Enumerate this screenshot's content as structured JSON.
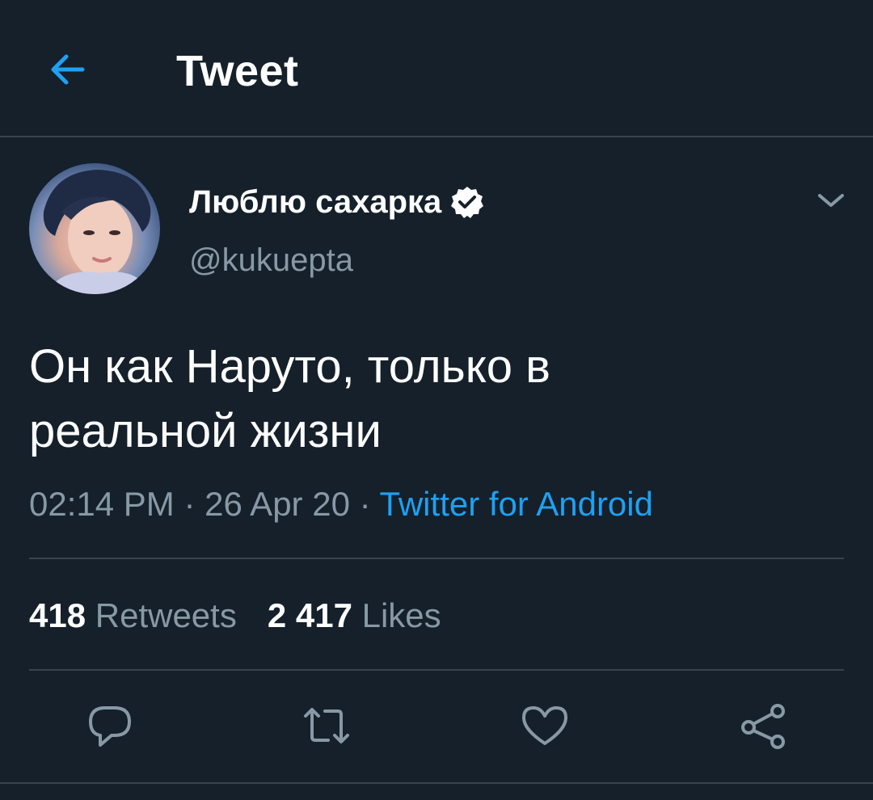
{
  "header": {
    "back_icon": "arrow-left-icon",
    "title": "Tweet"
  },
  "colors": {
    "background": "#15202b",
    "accent": "#1da1f2",
    "secondary_text": "#8899a6",
    "divider": "#38444d"
  },
  "tweet": {
    "author": {
      "display_name": "Люблю сахарка",
      "verified": true,
      "handle": "@kukuepta"
    },
    "text_line1": "Он как Наруто, только в",
    "text_line2": "реальной жизни",
    "time": "02:14 PM",
    "date": "26 Apr 20",
    "separator": " · ",
    "source": "Twitter for Android"
  },
  "stats": {
    "retweets_count": "418",
    "retweets_label": "Retweets",
    "likes_count": "2 417",
    "likes_label": "Likes"
  },
  "actions": {
    "reply_icon": "reply-icon",
    "retweet_icon": "retweet-icon",
    "like_icon": "heart-icon",
    "share_icon": "share-icon"
  }
}
